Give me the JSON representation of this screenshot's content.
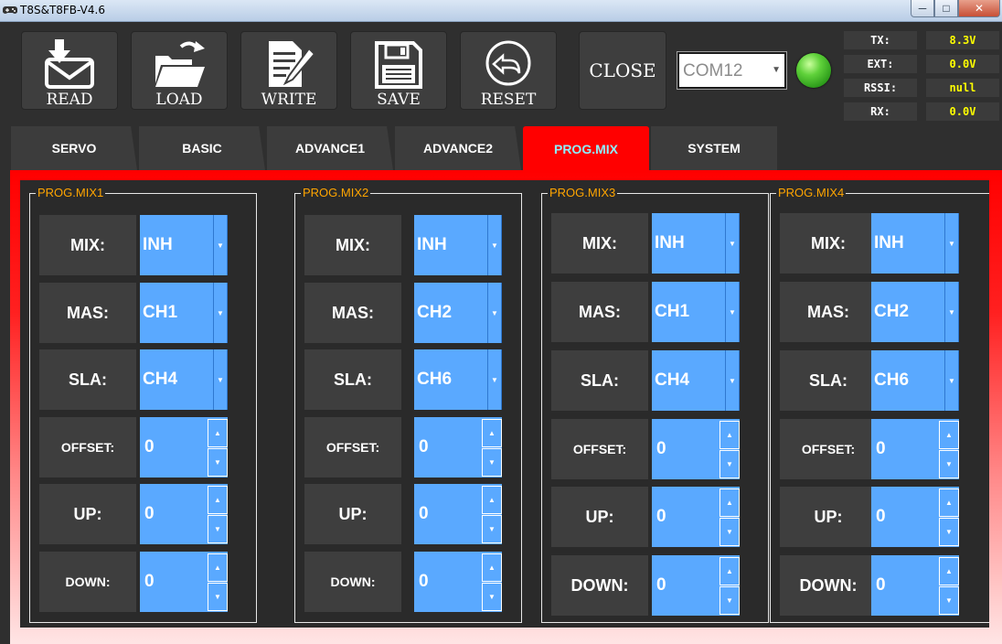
{
  "window": {
    "title": "T8S&T8FB-V4.6"
  },
  "toolbar": [
    {
      "label": "READ",
      "icon": "mail-download-icon"
    },
    {
      "label": "LOAD",
      "icon": "folder-open-icon"
    },
    {
      "label": "WRITE",
      "icon": "document-edit-icon"
    },
    {
      "label": "SAVE",
      "icon": "floppy-disk-icon"
    },
    {
      "label": "RESET",
      "icon": "reset-arrow-icon"
    }
  ],
  "close_label": "CLOSE",
  "port": {
    "value": "COM12"
  },
  "status": [
    {
      "label": "TX:",
      "value": "8.3V"
    },
    {
      "label": "EXT:",
      "value": "0.0V"
    },
    {
      "label": "RSSI:",
      "value": "null"
    },
    {
      "label": "RX:",
      "value": "0.0V"
    }
  ],
  "tabs": [
    "SERVO",
    "BASIC",
    "ADVANCE1",
    "ADVANCE2",
    "PROG.MIX",
    "SYSTEM"
  ],
  "active_tab": "PROG.MIX",
  "labels": {
    "mix": "MIX:",
    "mas": "MAS:",
    "sla": "SLA:",
    "offset": "OFFSET:",
    "up": "UP:",
    "down": "DOWN:"
  },
  "mixes": [
    {
      "title": "PROG.MIX1",
      "mix": "INH",
      "mas": "CH1",
      "sla": "CH4",
      "offset": "0",
      "up": "0",
      "down": "0"
    },
    {
      "title": "PROG.MIX2",
      "mix": "INH",
      "mas": "CH2",
      "sla": "CH6",
      "offset": "0",
      "up": "0",
      "down": "0"
    },
    {
      "title": "PROG.MIX3",
      "mix": "INH",
      "mas": "CH1",
      "sla": "CH4",
      "offset": "0",
      "up": "0",
      "down": "0"
    },
    {
      "title": "PROG.MIX4",
      "mix": "INH",
      "mas": "CH2",
      "sla": "CH6",
      "offset": "0",
      "up": "0",
      "down": "0"
    }
  ],
  "colors": {
    "panel_red": "#ff0000",
    "field_blue": "#5aa9ff",
    "group_title": "#ffa500",
    "status_value": "#ffff00",
    "active_tab_text": "#8ef0ff"
  }
}
